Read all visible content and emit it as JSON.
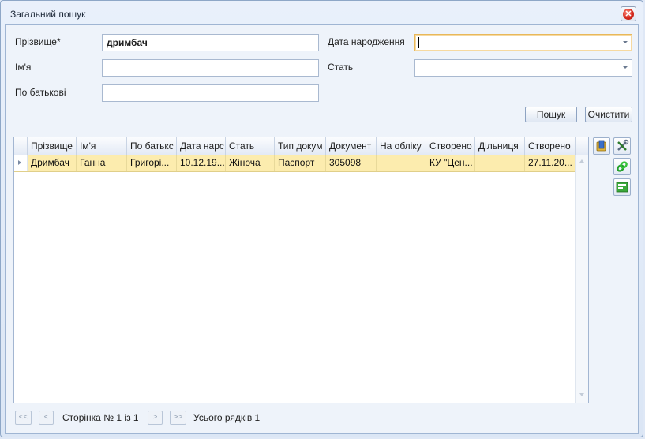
{
  "window": {
    "title": "Загальний пошук"
  },
  "form": {
    "surname_label": "Прізвище*",
    "surname_value": "дримбач",
    "name_label": "Ім'я",
    "name_value": "",
    "patronymic_label": "По батькові",
    "patronymic_value": "",
    "birthdate_label": "Дата народження",
    "birthdate_value": "",
    "sex_label": "Стать",
    "sex_value": ""
  },
  "buttons": {
    "search": "Пошук",
    "clear": "Очистити"
  },
  "grid": {
    "columns": [
      "Прізвище",
      "Ім'я",
      "По батькс",
      "Дата нарс",
      "Стать",
      "Тип докум",
      "Документ",
      "На обліку",
      "Створено",
      "Дільниця",
      "Створено"
    ],
    "rows": [
      [
        "Дримбач",
        "Ганна",
        "Григорі...",
        "10.12.19...",
        "Жіноча",
        "Паспорт",
        "305098",
        "",
        "КУ \"Цен...",
        "",
        "27.11.20..."
      ]
    ]
  },
  "side_icons": [
    "folder-icon",
    "tools-icon",
    "link-icon",
    "export-icon"
  ],
  "pager": {
    "first": "<<",
    "prev": "<",
    "page_text": "Сторінка № 1 із 1",
    "next": ">",
    "last": ">>",
    "total_text": "Усього рядків 1"
  }
}
